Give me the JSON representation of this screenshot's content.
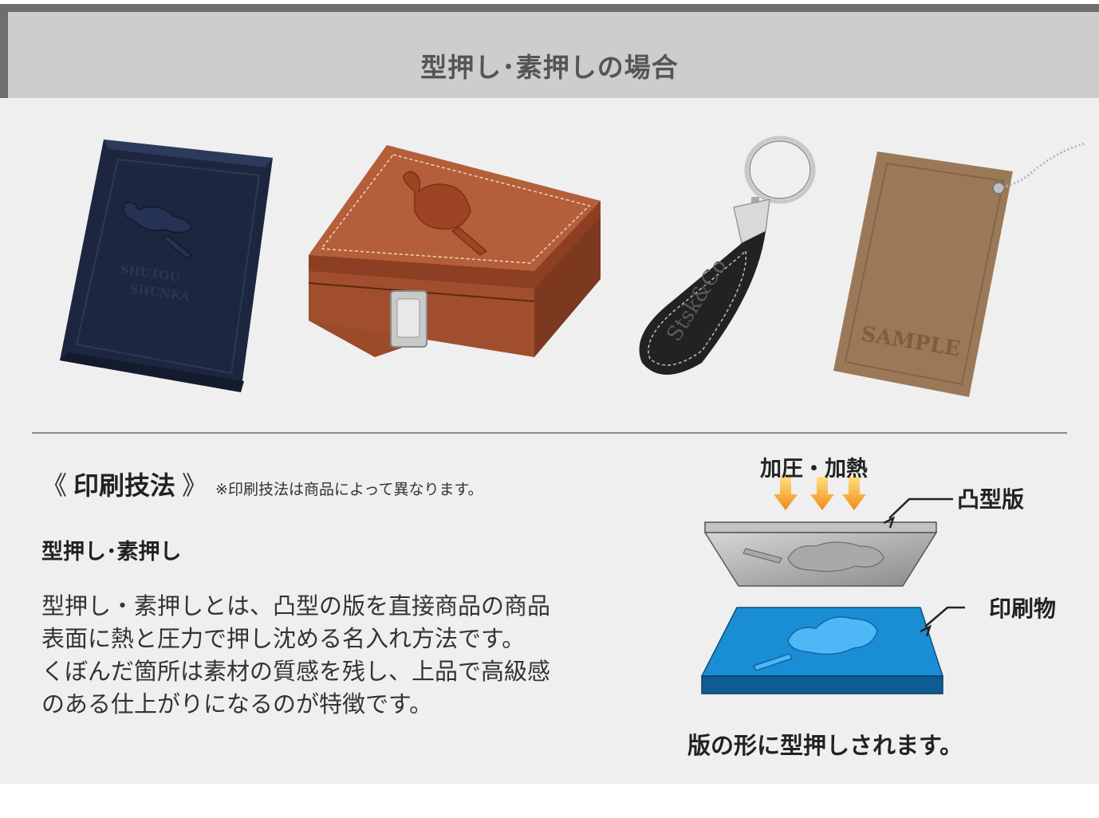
{
  "section": {
    "title": "型押し･素押しの場合"
  },
  "products": [
    {
      "name": "notebook-cover",
      "imprint": [
        "SHUTOU",
        "SHUNKA"
      ],
      "color": "#1f2b47"
    },
    {
      "name": "leather-box",
      "imprint": [],
      "color": "#a95330"
    },
    {
      "name": "shoehorn-keychain",
      "imprint": [
        "Stsk&Co"
      ],
      "color": "#1e1e1e"
    },
    {
      "name": "leather-tag",
      "imprint": [
        "SAMPLE"
      ],
      "color": "#9a7a5b"
    }
  ],
  "technique": {
    "open_bracket": "《",
    "label": "印刷技法",
    "close_bracket": "》",
    "note": "※印刷技法は商品によって異なります。"
  },
  "method": {
    "title": "型押し･素押し",
    "description": [
      "型押し・素押しとは、凸型の版を直接商品の商品",
      "表面に熱と圧力で押し沈める名入れ方法です。",
      "くぼんだ箇所は素材の質感を残し、上品で高級感",
      "のある仕上がりになるのが特徴です。"
    ]
  },
  "diagram": {
    "heat_label": "加圧・加熱",
    "plate_label": "凸型版",
    "print_label": "印刷物",
    "caption": "版の形に型押しされます。"
  }
}
